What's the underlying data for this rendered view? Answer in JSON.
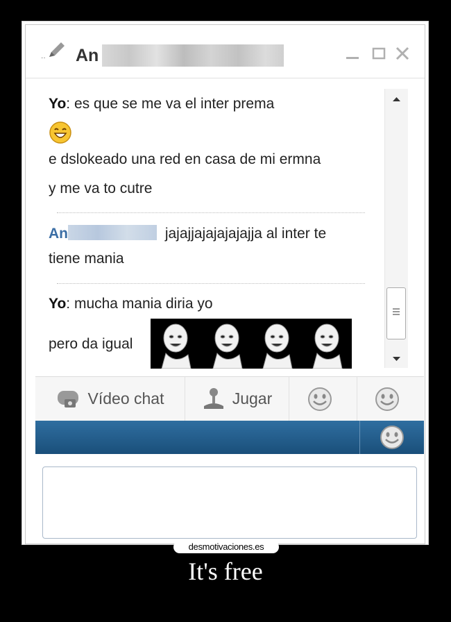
{
  "window": {
    "title_visible": "An",
    "min_label": "_",
    "max_label": "□",
    "close_label": "×"
  },
  "messages": {
    "line1_sender": "Yo",
    "line1_text": ": es que se me va el inter prema",
    "line2_text": "e dslokeado una red en casa de mi ermna",
    "line3_text": "y me va to cutre",
    "line4_sender": "An",
    "line4_text": " jajajjajajajajajja al inter te",
    "line5_text": "tiene mania",
    "line6_sender": "Yo",
    "line6_text": ": mucha mania diria yo",
    "line7_text": "pero da igual"
  },
  "toolbar": {
    "video_chat": "Vídeo chat",
    "jugar": "Jugar"
  },
  "footer": {
    "watermark": "desmotivaciones.es",
    "caption": "It's free"
  },
  "colors": {
    "link": "#3b6ea5",
    "bluebar": "#1f5b8b"
  },
  "icons": [
    "pencil-icon",
    "minimize-icon",
    "maximize-icon",
    "close-icon",
    "laughing-smiley-icon",
    "video-chat-icon",
    "joystick-icon",
    "smiley-icon"
  ]
}
